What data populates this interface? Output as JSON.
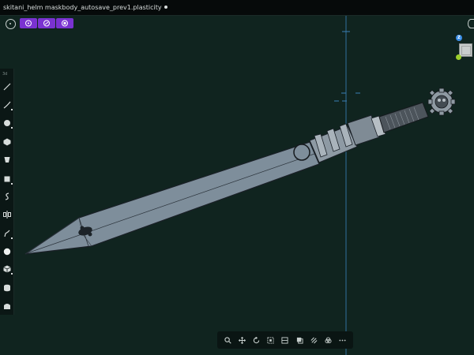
{
  "window": {
    "title": "skitani_helm maskbody_autosave_prev1.plasticity",
    "unsaved_indicator": "dot"
  },
  "top_toolbar": {
    "home_icon": "home-target-icon",
    "mode_buttons": [
      {
        "name": "vertex-mode",
        "icon": "vertex-select-icon"
      },
      {
        "name": "edge-mode",
        "icon": "edge-select-icon"
      },
      {
        "name": "face-mode",
        "icon": "face-select-icon"
      }
    ],
    "accent_color": "#7a32d1"
  },
  "left_toolbar": {
    "section_label": "3d",
    "tools": [
      {
        "name": "line",
        "icon": "line-tool-icon"
      },
      {
        "name": "curve",
        "icon": "curve-tool-icon"
      },
      {
        "name": "circle",
        "icon": "circle-tool-icon"
      },
      {
        "name": "polygon",
        "icon": "polygon-tool-icon"
      },
      {
        "name": "cylinder",
        "icon": "cup-tool-icon"
      },
      {
        "name": "box",
        "icon": "box-tool-icon"
      },
      {
        "name": "spiral",
        "icon": "spiral-tool-icon"
      },
      {
        "name": "mirror",
        "icon": "mirror-tool-icon"
      },
      {
        "name": "fillet",
        "icon": "fillet-tool-icon"
      },
      {
        "name": "sphere",
        "icon": "sphere-tool-icon"
      },
      {
        "name": "cube",
        "icon": "cube-tool-icon"
      },
      {
        "name": "cylinder-solid",
        "icon": "cylinder-tool-icon"
      },
      {
        "name": "extrude",
        "icon": "extrude-tool-icon"
      }
    ]
  },
  "bottom_toolbar": {
    "buttons": [
      {
        "name": "zoom",
        "icon": "magnifier-icon"
      },
      {
        "name": "pan",
        "icon": "move-arrows-icon"
      },
      {
        "name": "orbit",
        "icon": "rotate-icon"
      },
      {
        "name": "frame",
        "icon": "frame-icon"
      },
      {
        "name": "section",
        "icon": "section-icon"
      },
      {
        "name": "shaded",
        "icon": "shaded-icon"
      },
      {
        "name": "xray",
        "icon": "xray-icon"
      },
      {
        "name": "render",
        "icon": "render-icon"
      },
      {
        "name": "more",
        "icon": "more-dots-icon"
      }
    ]
  },
  "viewport": {
    "background_color": "#10241f",
    "model": "sword",
    "gizmo": {
      "z_label": "Z",
      "z_color": "#3a8ee8",
      "y_color": "#9ccf2c"
    }
  }
}
